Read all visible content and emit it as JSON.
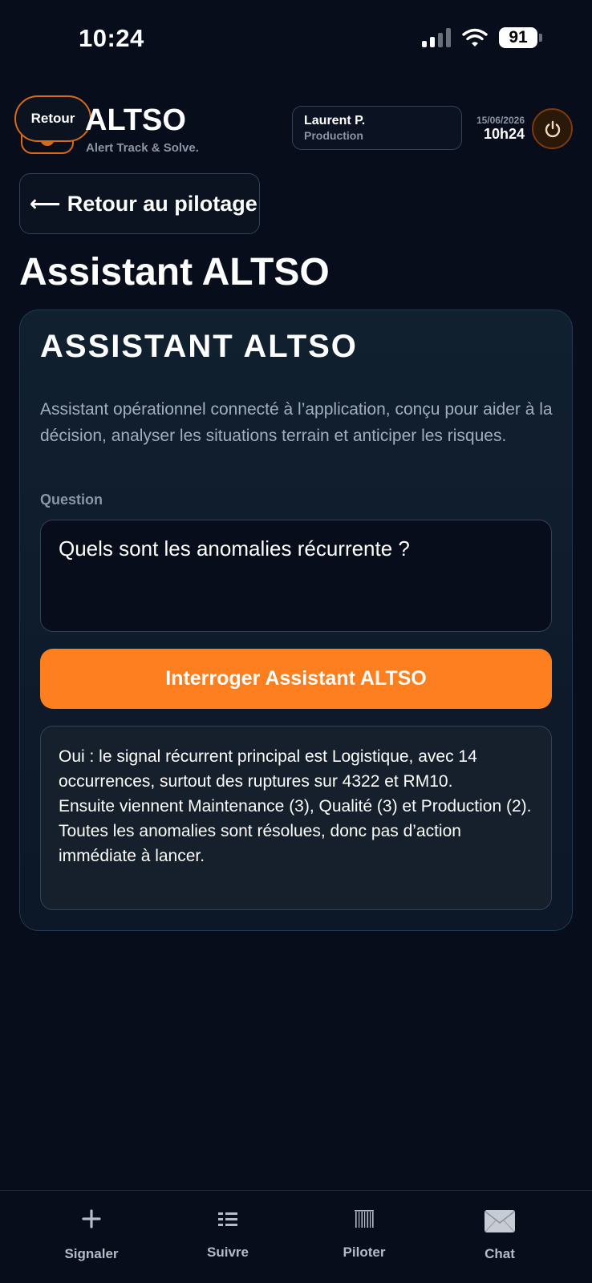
{
  "status_bar": {
    "time": "10:24",
    "battery": "91"
  },
  "header": {
    "back_label": "Retour",
    "brand_title": "ALTSO",
    "brand_tagline": "Alert Track & Solve.",
    "user_name": "Laurent P.",
    "user_role": "Production",
    "date": "15/06/2026",
    "time": "10h24"
  },
  "back_to_piloting": {
    "arrow": "⟵",
    "label": "Retour au pilotage"
  },
  "page_title": "Assistant ALTSO",
  "card": {
    "title": "ASSISTANT ALTSO",
    "description": "Assistant opérationnel connecté à l’application, conçu pour aider à la décision, analyser les situations terrain et anticiper les risques.",
    "question_label": "Question",
    "question_value": "Quels sont les anomalies récurrente ?",
    "ask_button": "Interroger Assistant ALTSO",
    "answer": {
      "line1": "Oui : le signal récurrent principal est Logistique, avec 14 occurrences, surtout des ruptures sur 4322 et RM10.",
      "line2": "Ensuite viennent Maintenance (3), Qualité (3) et Production (2).",
      "line3": "Toutes les anomalies sont résolues, donc pas d’action immédiate à lancer."
    }
  },
  "nav": {
    "items": [
      {
        "label": "Signaler",
        "icon": "plus-icon"
      },
      {
        "label": "Suivre",
        "icon": "list-icon"
      },
      {
        "label": "Piloter",
        "icon": "barcode-icon"
      },
      {
        "label": "Chat",
        "icon": "envelope-icon"
      }
    ]
  },
  "colors": {
    "accent": "#fd7f20",
    "background": "#070d1a",
    "border": "#334155"
  }
}
